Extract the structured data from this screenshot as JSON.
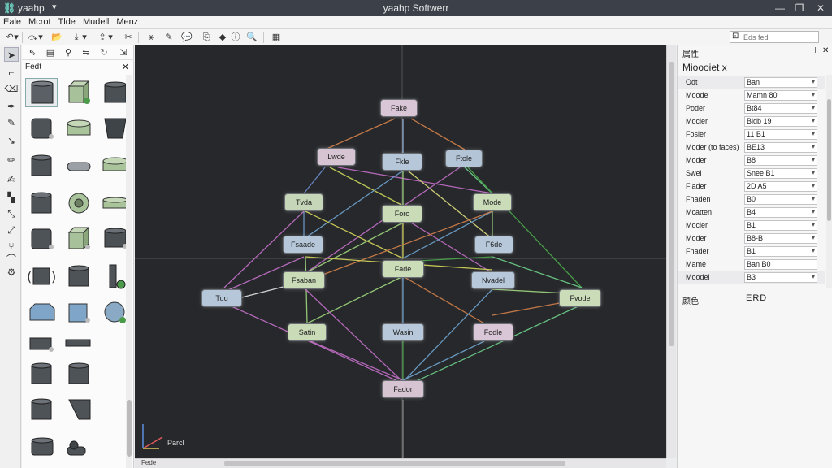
{
  "titlebar": {
    "app_name": "yaahp",
    "window_title": "yaahp Softwerr",
    "controls": [
      "—",
      "❐",
      "✕"
    ]
  },
  "menu": [
    "Eale",
    "Mcrot",
    "Tlde",
    "Mudell",
    "Menz"
  ],
  "toolbar": {
    "search_placeholder": "Eds fed",
    "search_icon_text": "⊡"
  },
  "palette": {
    "title": "Fedt",
    "close": "✕"
  },
  "canvas": {
    "background": "#26282b",
    "axis_label": "Parcl",
    "bottom_label": "Fede",
    "nodes": [
      {
        "label": "Fake",
        "color": "#d9c6d6"
      },
      {
        "label": "Lwde",
        "color": "#d6c4d2"
      },
      {
        "label": "Fkle",
        "color": "#b6c7d9"
      },
      {
        "label": "Ftole",
        "color": "#b3c4d6"
      },
      {
        "label": "Tvda",
        "color": "#c6d6b8"
      },
      {
        "label": "Foro",
        "color": "#c9dbb7"
      },
      {
        "label": "Mode",
        "color": "#cbdcb9"
      },
      {
        "label": "Fsaade",
        "color": "#b6c7d9"
      },
      {
        "label": "F6de",
        "color": "#b6c8da"
      },
      {
        "label": "Fsaban",
        "color": "#c9dbb7"
      },
      {
        "label": "Fade",
        "color": "#cbdcb9"
      },
      {
        "label": "Nvadel",
        "color": "#b6c8da"
      },
      {
        "label": "Tuo",
        "color": "#b6c7d9"
      },
      {
        "label": "Fvode",
        "color": "#cbdcb9"
      },
      {
        "label": "Satin",
        "color": "#c9dbb7"
      },
      {
        "label": "Wasin",
        "color": "#b6c8da"
      },
      {
        "label": "Fodle",
        "color": "#d9c6d6"
      },
      {
        "label": "Fador",
        "color": "#d6c4d2"
      }
    ]
  },
  "properties": {
    "panel_title": "属性",
    "pin": "⊣",
    "close": "✕",
    "object_title": "Mioooiet x",
    "rows": [
      {
        "key": "Odt",
        "value": "Ban",
        "dropdown": true
      },
      {
        "key": "Moode",
        "value": "Mamn    80",
        "dropdown": true
      },
      {
        "key": "Poder",
        "value": "Bt84",
        "dropdown": true
      },
      {
        "key": "Mocler",
        "value": "Bidb  19",
        "dropdown": true
      },
      {
        "key": "Fosler",
        "value": "11       B1",
        "dropdown": true
      },
      {
        "key": "Moder (to faces)",
        "value": "BE13",
        "dropdown": true
      },
      {
        "key": "Moder",
        "value": "B8",
        "dropdown": true
      },
      {
        "key": "Swel",
        "value": "Snee  B1",
        "dropdown": true
      },
      {
        "key": "Flader",
        "value": "2D     A5",
        "dropdown": true
      },
      {
        "key": "Fhaden",
        "value": "B0",
        "dropdown": true
      },
      {
        "key": "Mcatten",
        "value": "B4",
        "dropdown": true
      },
      {
        "key": "Mocler",
        "value": "B1",
        "dropdown": true
      },
      {
        "key": "Moder",
        "value": "B8-B",
        "dropdown": true
      },
      {
        "key": "Fhader",
        "value": "B1",
        "dropdown": true
      },
      {
        "key": "Mame",
        "value": "Ban   B0",
        "dropdown": false
      },
      {
        "key": "Moodel",
        "value": "B3",
        "dropdown": true
      }
    ],
    "footer_key": "颜色",
    "footer_value": "ERD"
  }
}
